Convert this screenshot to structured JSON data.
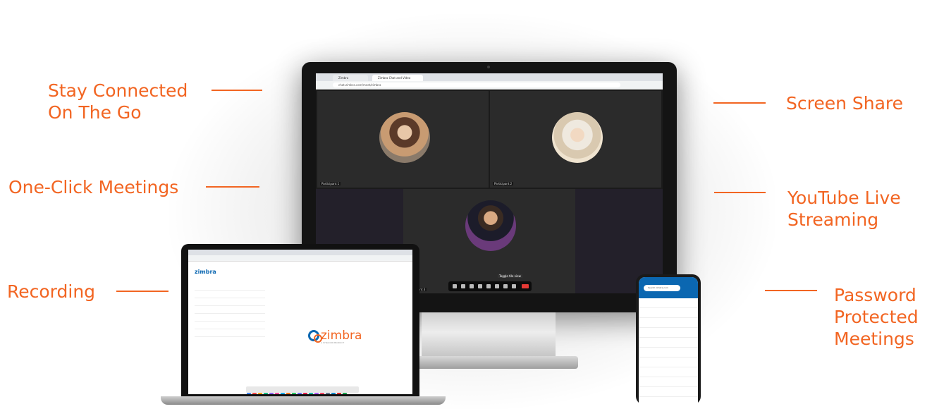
{
  "features": {
    "stay_connected": [
      "Stay Connected",
      "On The Go"
    ],
    "one_click": [
      "One-Click Meetings"
    ],
    "recording": [
      "Recording"
    ],
    "screen_share": [
      "Screen Share"
    ],
    "youtube": [
      "YouTube Live",
      "Streaming"
    ],
    "password": [
      "Password",
      "Protected",
      "Meetings"
    ]
  },
  "colors": {
    "accent": "#f26522",
    "zimbra_blue": "#0b67b1",
    "monitor_bezel": "#141414"
  },
  "monitor": {
    "tab1": "Zimbra",
    "tab2": "Zimbra Chat and Video",
    "url": "chat.zimbra.com/meet/zimbra",
    "participants": [
      {
        "name": "Participant 1"
      },
      {
        "name": "Participant 2"
      },
      {
        "name": "Participant 3"
      }
    ],
    "tooltip": "Toggle tile view"
  },
  "laptop": {
    "logo": "zimbra",
    "brand": "zimbra",
    "brand_sub": "A SYNACOR PRODUCT"
  },
  "phone": {
    "search": "Search zimbra.com"
  }
}
